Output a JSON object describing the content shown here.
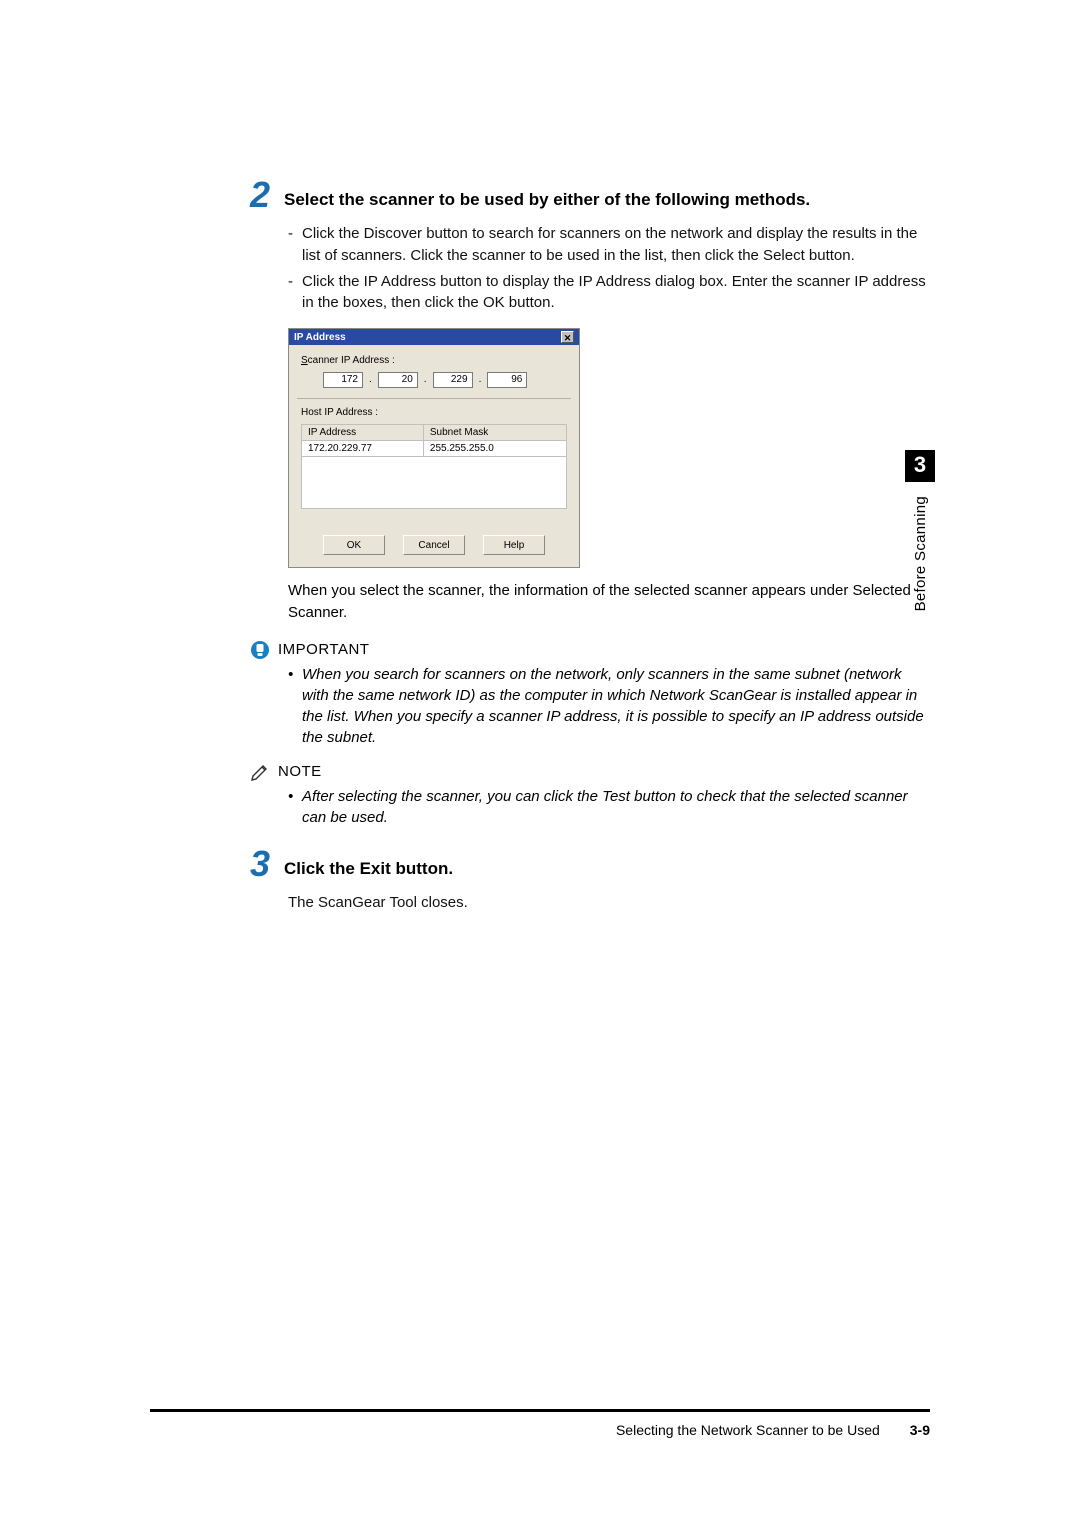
{
  "step2": {
    "num": "2",
    "title": "Select the scanner to be used by either of the following methods.",
    "bullets": [
      "Click the Discover button to search for scanners on the network and display the results in the list of scanners. Click the scanner to be used in the list, then click the Select button.",
      "Click the IP Address button to display the IP Address dialog box. Enter the scanner IP address in the boxes, then click the OK button."
    ]
  },
  "dialog": {
    "title": "IP Address",
    "close_glyph": "✕",
    "scanner_label_prefix": "S",
    "scanner_label_rest": "canner IP Address :",
    "ip_parts": [
      "172",
      "20",
      "229",
      "96"
    ],
    "host_label": "Host IP Address :",
    "col_ip": "IP Address",
    "col_mask": "Subnet Mask",
    "row_ip": "172.20.229.77",
    "row_mask": "255.255.255.0",
    "btn_ok": "OK",
    "btn_cancel": "Cancel",
    "btn_help": "Help"
  },
  "after_dialog": "When you select the scanner, the information of the selected scanner appears under Selected Scanner.",
  "important": {
    "label": "IMPORTANT",
    "text": "When you search for scanners on the network, only scanners in the same subnet (network with the same network ID) as the computer in which Network ScanGear is installed appear in the list. When you specify a scanner IP address, it is possible to specify an IP address outside the subnet."
  },
  "note": {
    "label": "NOTE",
    "text": "After selecting the scanner, you can click the Test button to check that the selected scanner can be used."
  },
  "step3": {
    "num": "3",
    "title": "Click the Exit button.",
    "body": "The ScanGear Tool closes."
  },
  "side": {
    "chapter": "3",
    "section": "Before Scanning"
  },
  "footer": {
    "title": "Selecting the Network Scanner to be Used",
    "page": "3-9"
  }
}
